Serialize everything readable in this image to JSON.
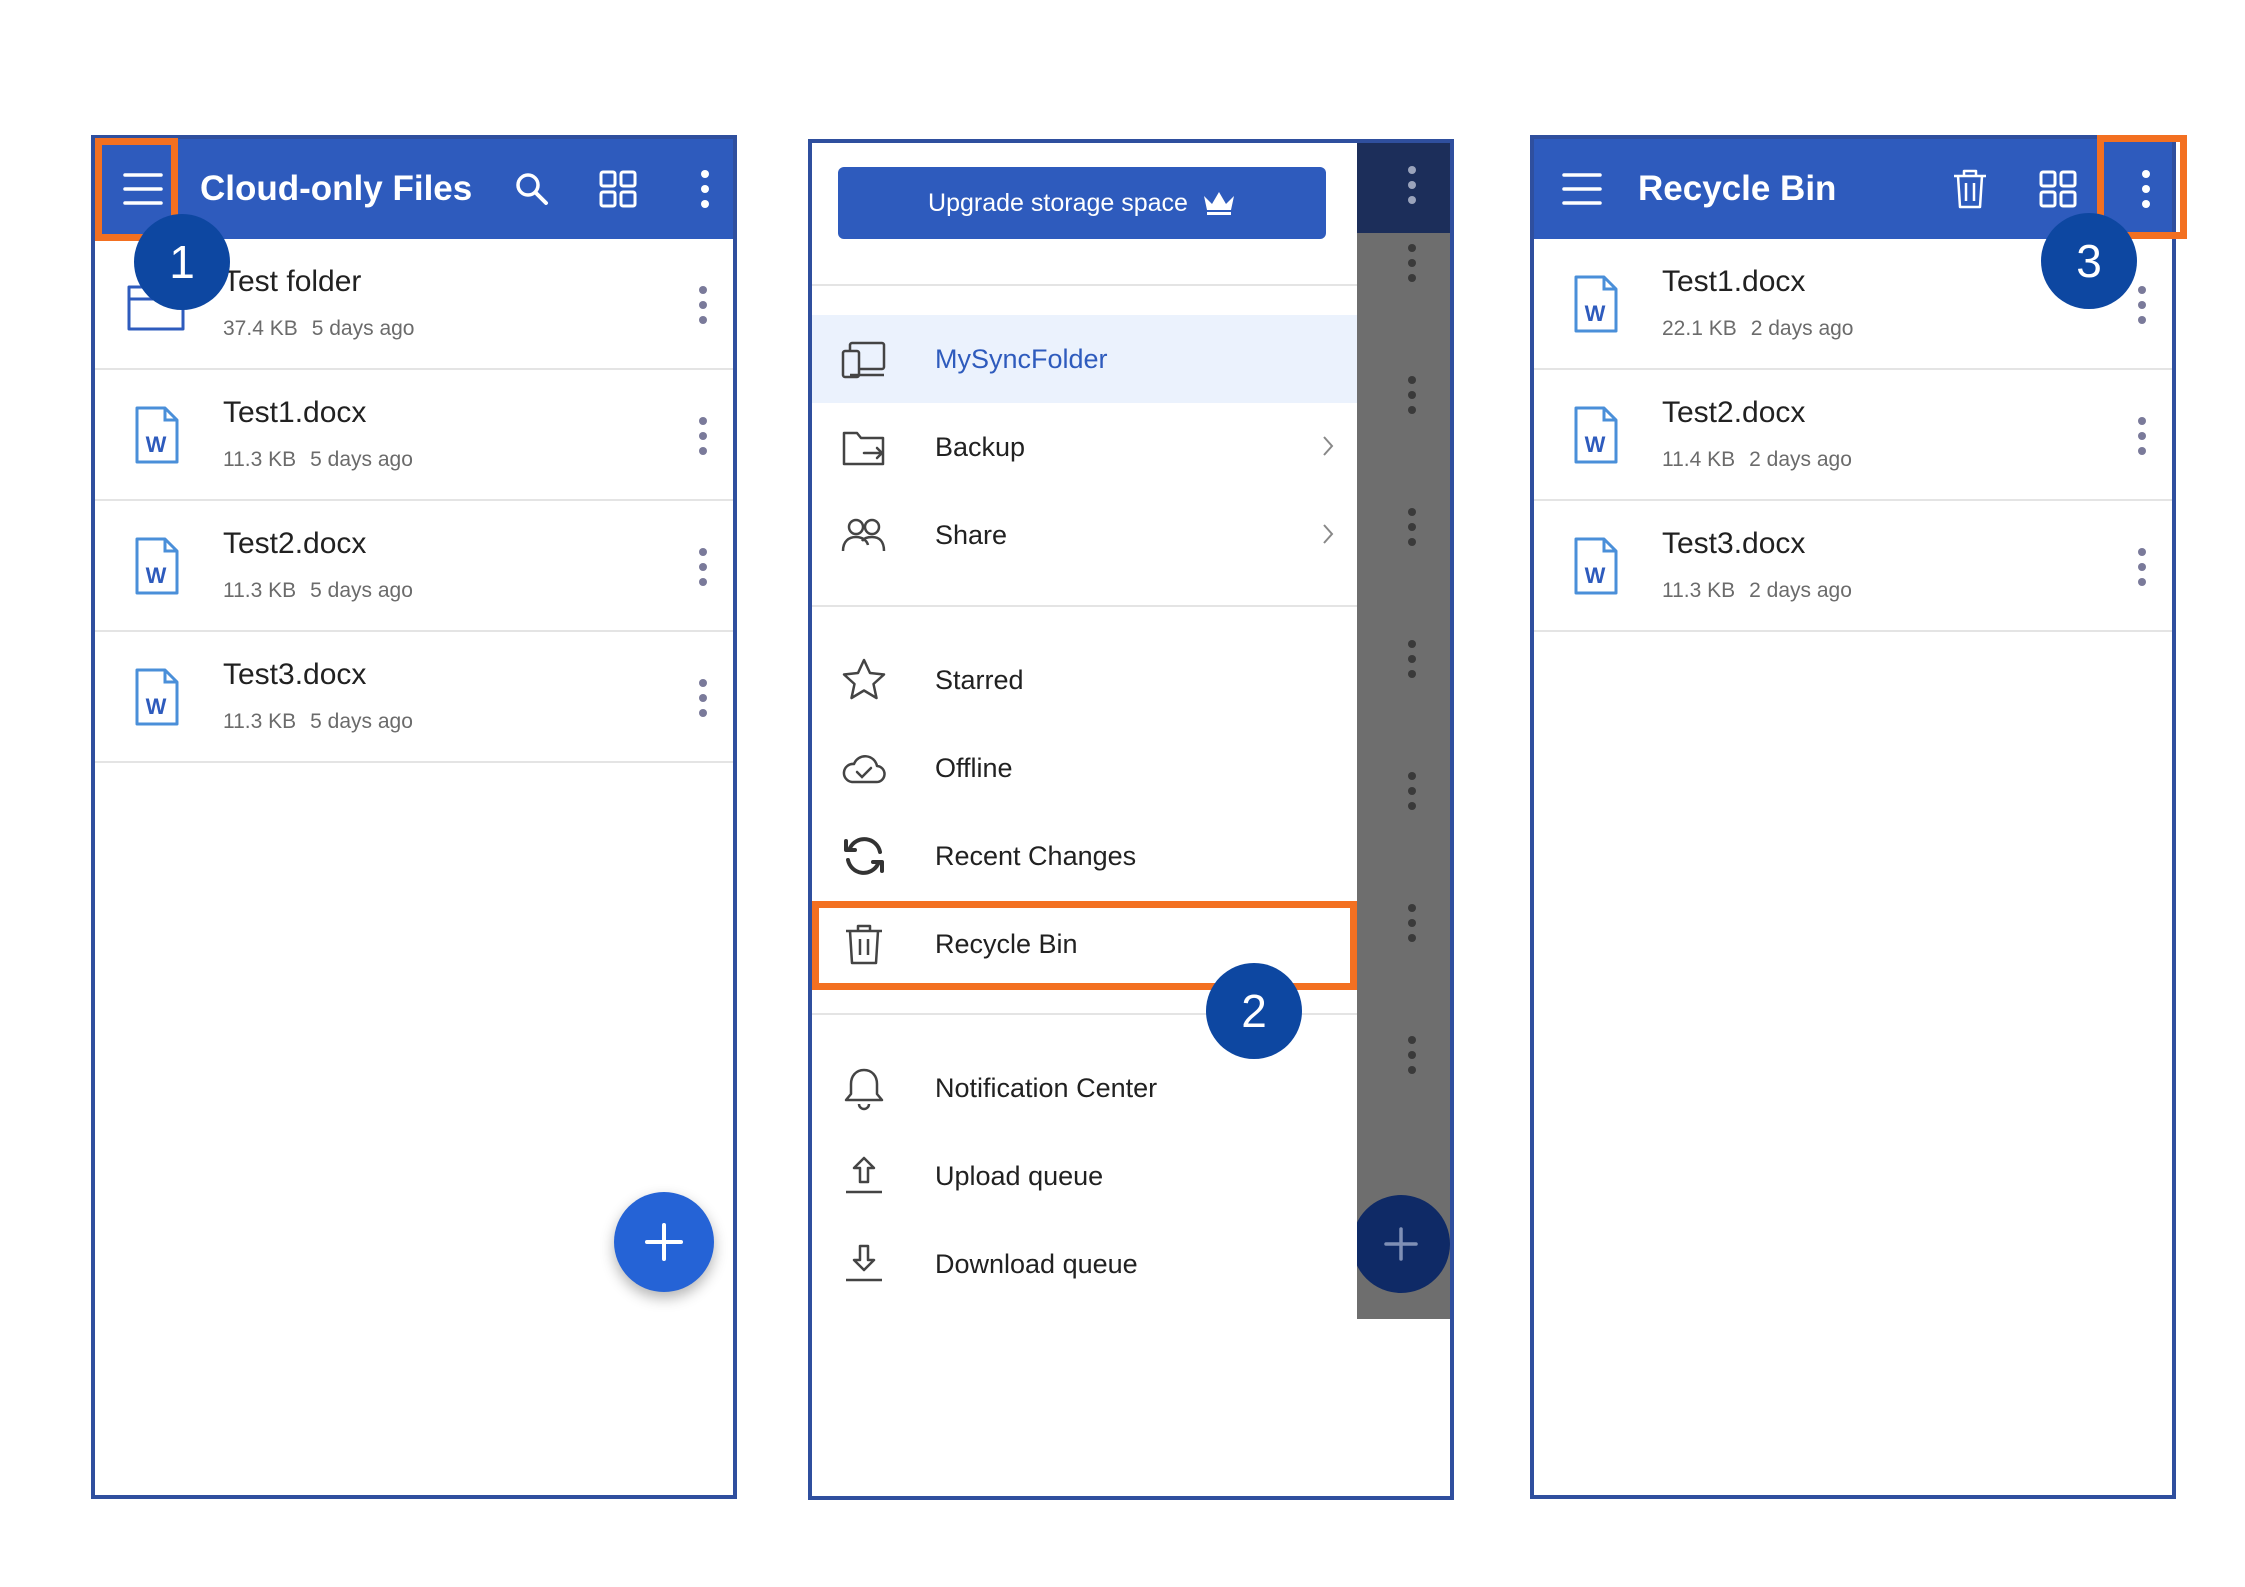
{
  "steps": [
    "1",
    "2",
    "3"
  ],
  "screen1": {
    "title": "Cloud-only Files",
    "icons": [
      "menu-icon",
      "search-icon",
      "grid-view-icon",
      "more-vert-icon"
    ],
    "files": [
      {
        "name": "Test folder",
        "size": "37.4 KB",
        "modified": "5 days ago",
        "type": "folder"
      },
      {
        "name": "Test1.docx",
        "size": "11.3 KB",
        "modified": "5 days ago",
        "type": "word"
      },
      {
        "name": "Test2.docx",
        "size": "11.3 KB",
        "modified": "5 days ago",
        "type": "word"
      },
      {
        "name": "Test3.docx",
        "size": "11.3 KB",
        "modified": "5 days ago",
        "type": "word"
      }
    ],
    "fab_icon": "plus-icon"
  },
  "screen2": {
    "upgrade_label": "Upgrade storage space",
    "upgrade_icon": "crown-icon",
    "menu": [
      {
        "label": "MySyncFolder",
        "icon": "sync-folder-icon",
        "active": true
      },
      {
        "label": "Backup",
        "icon": "backup-icon",
        "chevron": true
      },
      {
        "label": "Share",
        "icon": "share-people-icon",
        "chevron": true
      },
      {
        "label": "Starred",
        "icon": "star-icon"
      },
      {
        "label": "Offline",
        "icon": "cloud-check-icon"
      },
      {
        "label": "Recent Changes",
        "icon": "refresh-icon"
      },
      {
        "label": "Recycle Bin",
        "icon": "trash-icon"
      },
      {
        "label": "Notification Center",
        "icon": "bell-icon"
      },
      {
        "label": "Upload queue",
        "icon": "upload-icon"
      },
      {
        "label": "Download queue",
        "icon": "download-icon"
      }
    ]
  },
  "screen3": {
    "title": "Recycle Bin",
    "icons": [
      "menu-icon",
      "trash-icon",
      "grid-view-icon",
      "more-vert-icon"
    ],
    "files": [
      {
        "name": "Test1.docx",
        "size": "22.1 KB",
        "modified": "2 days ago",
        "type": "word"
      },
      {
        "name": "Test2.docx",
        "size": "11.4 KB",
        "modified": "2 days ago",
        "type": "word"
      },
      {
        "name": "Test3.docx",
        "size": "11.3 KB",
        "modified": "2 days ago",
        "type": "word"
      }
    ]
  },
  "colors": {
    "appbar": "#2e5bbd",
    "callout": "#f37021",
    "step_badge": "#0d47a1",
    "fab": "#2563d6",
    "phone_border": "#2f4f9e"
  }
}
